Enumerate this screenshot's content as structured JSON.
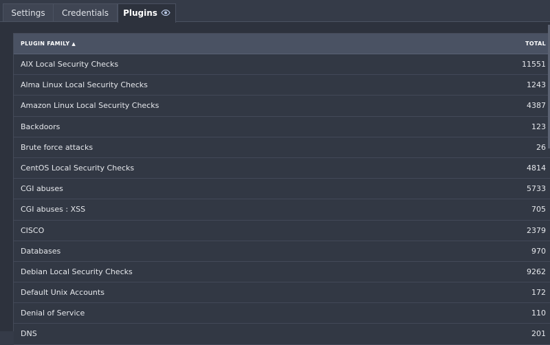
{
  "tabs": [
    {
      "label": "Settings"
    },
    {
      "label": "Credentials"
    },
    {
      "label": "Plugins",
      "active": true,
      "icon": "eye-icon"
    }
  ],
  "table": {
    "columns": {
      "family": "PLUGIN FAMILY",
      "sort_indicator": "▲",
      "total": "TOTAL"
    },
    "rows": [
      {
        "family": "AIX Local Security Checks",
        "total": "11551"
      },
      {
        "family": "Alma Linux Local Security Checks",
        "total": "1243"
      },
      {
        "family": "Amazon Linux Local Security Checks",
        "total": "4387"
      },
      {
        "family": "Backdoors",
        "total": "123"
      },
      {
        "family": "Brute force attacks",
        "total": "26"
      },
      {
        "family": "CentOS Local Security Checks",
        "total": "4814"
      },
      {
        "family": "CGI abuses",
        "total": "5733"
      },
      {
        "family": "CGI abuses : XSS",
        "total": "705"
      },
      {
        "family": "CISCO",
        "total": "2379"
      },
      {
        "family": "Databases",
        "total": "970"
      },
      {
        "family": "Debian Local Security Checks",
        "total": "9262"
      },
      {
        "family": "Default Unix Accounts",
        "total": "172"
      },
      {
        "family": "Denial of Service",
        "total": "110"
      },
      {
        "family": "DNS",
        "total": "201"
      }
    ]
  },
  "colors": {
    "background": "#2d323d",
    "header": "#4a5263",
    "row": "#323844",
    "text": "#e6e8ec"
  }
}
